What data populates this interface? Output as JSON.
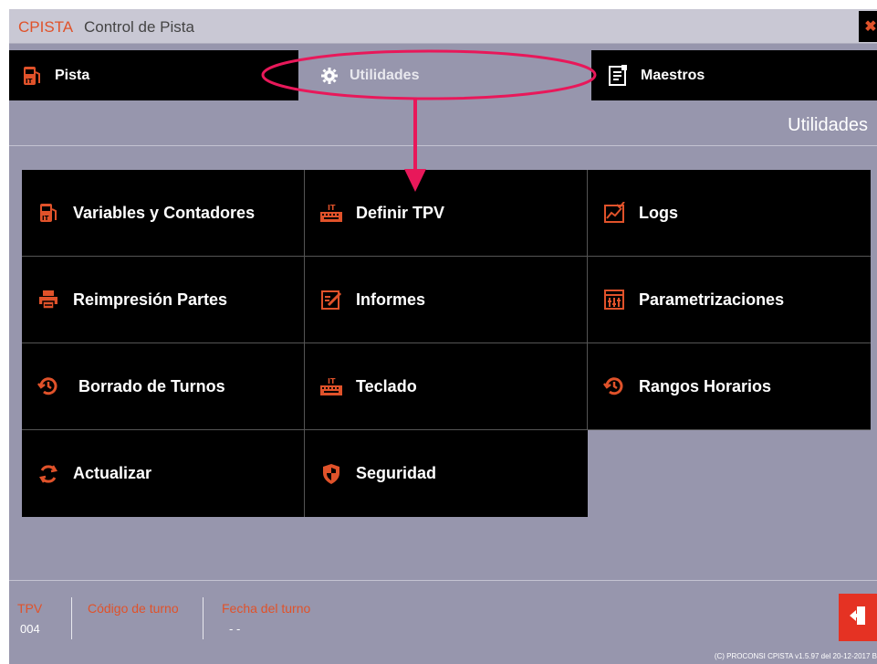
{
  "window": {
    "brand": "CPISTA",
    "title": "Control de Pista",
    "close_icon": "close-x-icon"
  },
  "tabs": [
    {
      "label": "Pista",
      "icon": "fuel-pump-icon",
      "active": false
    },
    {
      "label": "Utilidades",
      "icon": "gear-icon",
      "active": true
    },
    {
      "label": "Maestros",
      "icon": "document-list-icon",
      "active": false
    }
  ],
  "section": {
    "title": "Utilidades"
  },
  "menu": [
    {
      "label": "Variables y Contadores",
      "icon": "fuel-pump-icon"
    },
    {
      "label": "Definir TPV",
      "icon": "keyboard-icon"
    },
    {
      "label": "Logs",
      "icon": "chart-check-icon"
    },
    {
      "label": "Reimpresión Partes",
      "icon": "printer-icon"
    },
    {
      "label": "Informes",
      "icon": "edit-report-icon"
    },
    {
      "label": "Parametrizaciones",
      "icon": "settings-window-icon"
    },
    {
      "label": "Borrado de Turnos",
      "icon": "history-icon"
    },
    {
      "label": "Teclado",
      "icon": "keyboard-icon"
    },
    {
      "label": "Rangos Horarios",
      "icon": "history-icon"
    },
    {
      "label": "Actualizar",
      "icon": "refresh-icon"
    },
    {
      "label": "Seguridad",
      "icon": "shield-icon"
    }
  ],
  "footer": {
    "tpv_label": "TPV",
    "tpv_value": "004",
    "turno_label": "Código de turno",
    "turno_value": "",
    "fecha_label": "Fecha del turno",
    "fecha_value": "- -",
    "exit_icon": "exit-door-icon",
    "copyright": "(C) PROCONSI CPISTA v1.5.97 del 20-12-2017 B"
  },
  "colors": {
    "accent": "#e0522a",
    "background": "#9796ad",
    "tile": "#000000",
    "annotation": "#e8185a"
  }
}
